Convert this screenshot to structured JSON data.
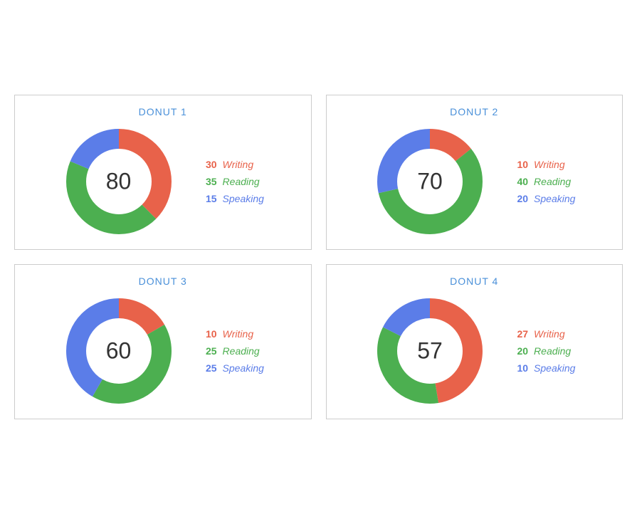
{
  "donuts": [
    {
      "id": "donut1",
      "title": "DONUT 1",
      "center": "80",
      "segments": [
        {
          "label": "Writing",
          "value": 30,
          "color": "#e8624a"
        },
        {
          "label": "Reading",
          "value": 35,
          "color": "#4caf50"
        },
        {
          "label": "Speaking",
          "value": 15,
          "color": "#5b7de8"
        }
      ]
    },
    {
      "id": "donut2",
      "title": "DONUT 2",
      "center": "70",
      "segments": [
        {
          "label": "Writing",
          "value": 10,
          "color": "#e8624a"
        },
        {
          "label": "Reading",
          "value": 40,
          "color": "#4caf50"
        },
        {
          "label": "Speaking",
          "value": 20,
          "color": "#5b7de8"
        }
      ]
    },
    {
      "id": "donut3",
      "title": "DONUT 3",
      "center": "60",
      "segments": [
        {
          "label": "Writing",
          "value": 10,
          "color": "#e8624a"
        },
        {
          "label": "Reading",
          "value": 25,
          "color": "#4caf50"
        },
        {
          "label": "Speaking",
          "value": 25,
          "color": "#5b7de8"
        }
      ]
    },
    {
      "id": "donut4",
      "title": "DONUT 4",
      "center": "57",
      "segments": [
        {
          "label": "Writing",
          "value": 27,
          "color": "#e8624a"
        },
        {
          "label": "Reading",
          "value": 20,
          "color": "#4caf50"
        },
        {
          "label": "Speaking",
          "value": 10,
          "color": "#5b7de8"
        }
      ]
    }
  ],
  "colorClasses": {
    "Writing": "color-writing",
    "Reading": "color-reading",
    "Speaking": "color-speaking"
  }
}
